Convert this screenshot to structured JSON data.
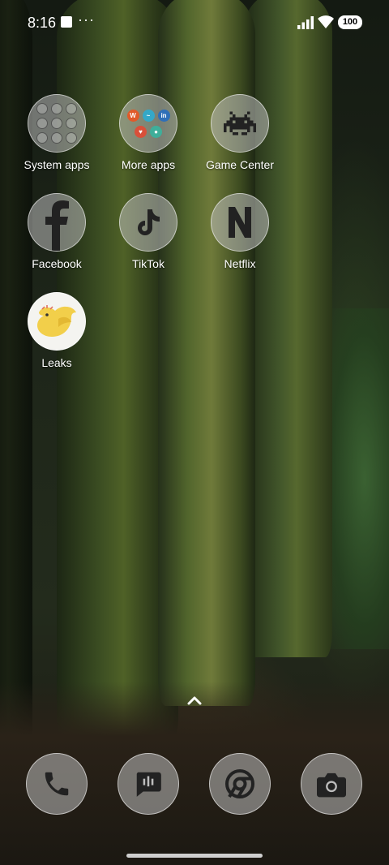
{
  "status_bar": {
    "time": "8:16",
    "battery": "100",
    "icons": [
      "notification-square-icon",
      "more-dots-icon",
      "signal-icon",
      "wifi-icon",
      "battery-icon"
    ]
  },
  "apps": [
    {
      "label": "System apps",
      "icon": "folder-icon"
    },
    {
      "label": "More apps",
      "icon": "folder-icon"
    },
    {
      "label": "Game Center",
      "icon": "space-invader-icon"
    },
    {
      "label": "Facebook",
      "icon": "facebook-icon"
    },
    {
      "label": "TikTok",
      "icon": "music-note-icon"
    },
    {
      "label": "Netflix",
      "icon": "netflix-n-icon"
    },
    {
      "label": "Leaks",
      "icon": "yellow-bird-icon"
    }
  ],
  "more_apps_folder": {
    "mini_icons": [
      {
        "glyph": "W",
        "color": "#e05a2a"
      },
      {
        "glyph": "~",
        "color": "#34a8c8"
      },
      {
        "glyph": "in",
        "color": "#2f6fb8"
      },
      {
        "glyph": "♥",
        "color": "#d9503a"
      },
      {
        "glyph": "●",
        "color": "#3fae9a"
      }
    ]
  },
  "dock": [
    {
      "name": "phone",
      "icon": "phone-icon"
    },
    {
      "name": "messages",
      "icon": "message-icon"
    },
    {
      "name": "chrome",
      "icon": "chrome-icon"
    },
    {
      "name": "camera",
      "icon": "camera-icon"
    }
  ],
  "colors": {
    "icon_bg": "#bebebe",
    "icon_glyph": "#222222",
    "leaks_bg": "#f4f4f0",
    "leaks_bird": "#f2cf4a"
  }
}
